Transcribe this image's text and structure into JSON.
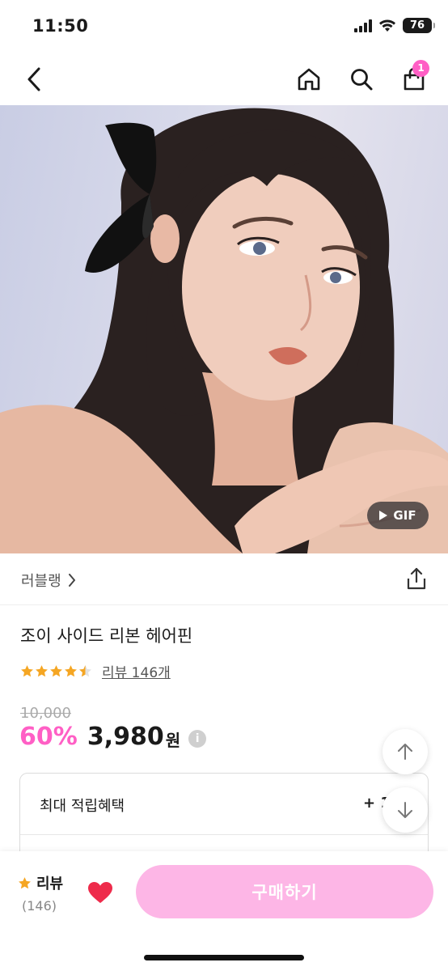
{
  "status_bar": {
    "time": "11:50",
    "battery": "76",
    "icons": [
      "signal-icon",
      "wifi-icon",
      "battery-icon"
    ]
  },
  "nav": {
    "icons": [
      "back-arrow-icon",
      "home-icon",
      "search-icon",
      "cart-icon"
    ],
    "cart_badge": "1"
  },
  "product_image": {
    "gif_label": "GIF",
    "icons": [
      "play-icon"
    ]
  },
  "brand": {
    "name": "러블랭",
    "icons": [
      "chevron-right-icon",
      "share-icon"
    ]
  },
  "product": {
    "title": "조이 사이드 리본 헤어핀",
    "rating": 4.5,
    "review_link": "리뷰 146개",
    "original_price": "10,000",
    "discount": "60%",
    "price": "3,980",
    "price_unit": "원",
    "info_icon": "i"
  },
  "benefit": {
    "label": "최대 적립혜택",
    "value": "+ 1"
  },
  "scroll": {
    "icons": [
      "arrow-up-icon",
      "arrow-down-icon"
    ]
  },
  "bottom_bar": {
    "review_label": "리뷰",
    "review_count": "(146)",
    "buy_label": "구매하기"
  },
  "colors": {
    "accent_pink": "#ff5fc5",
    "buy_button": "#fdb6e6",
    "star": "#f5a623",
    "heart": "#ee2b4b"
  }
}
